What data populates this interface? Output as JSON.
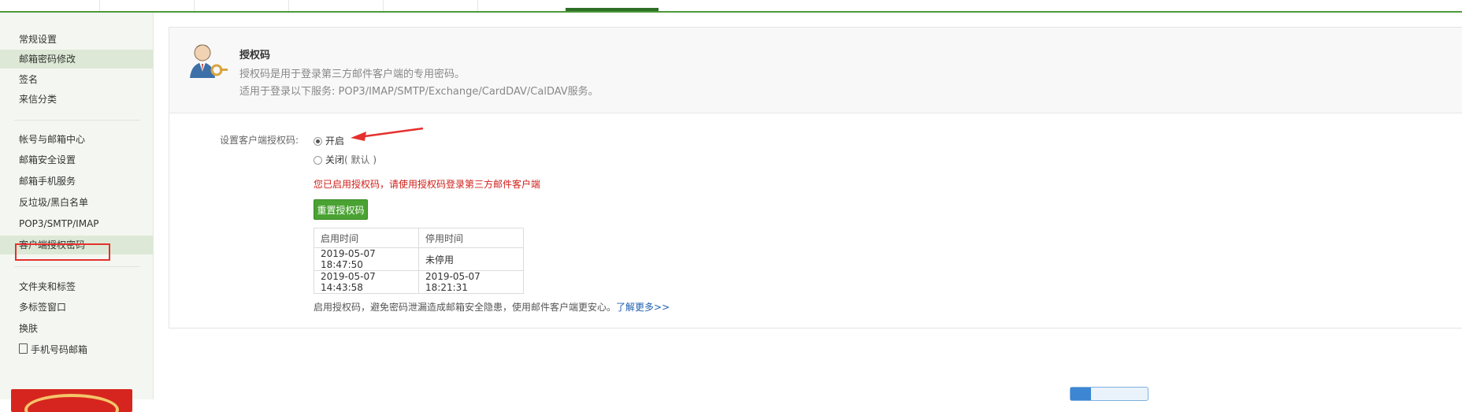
{
  "sidebar": {
    "group1": [
      "常规设置",
      "邮箱密码修改",
      "签名",
      "来信分类"
    ],
    "group2": [
      "帐号与邮箱中心",
      "邮箱安全设置",
      "邮箱手机服务",
      "反垃圾/黑白名单",
      "POP3/SMTP/IMAP",
      "客户端授权密码"
    ],
    "group3": [
      "文件夹和标签",
      "多标签窗口",
      "换肤",
      "手机号码邮箱"
    ]
  },
  "header": {
    "title": "授权码",
    "line1": "授权码是用于登录第三方邮件客户端的专用密码。",
    "line2": "适用于登录以下服务: POP3/IMAP/SMTP/Exchange/CardDAV/CalDAV服务。"
  },
  "form": {
    "label": "设置客户端授权码:",
    "option_on": "开启",
    "option_off": "关闭",
    "option_off_note": "( 默认 )",
    "selected": "开启",
    "notice": "您已启用授权码，请使用授权码登录第三方邮件客户端",
    "reset_button": "重置授权码"
  },
  "table": {
    "headers": [
      "启用时间",
      "停用时间"
    ],
    "rows": [
      [
        "2019-05-07 18:47:50",
        "未停用"
      ],
      [
        "2019-05-07 14:43:58",
        "2019-05-07 18:21:31"
      ]
    ]
  },
  "footnote": {
    "text": "启用授权码，避免密码泄漏造成邮箱安全隐患，使用邮件客户端更安心。",
    "link": "了解更多>>"
  },
  "colors": {
    "accent_green": "#4aa233",
    "notice_red": "#d0201a",
    "link_blue": "#1f5fb0",
    "annotation_red": "#e5302d"
  },
  "icons": {
    "header": "user-key-icon",
    "arrow": "red-arrow-annotation"
  }
}
